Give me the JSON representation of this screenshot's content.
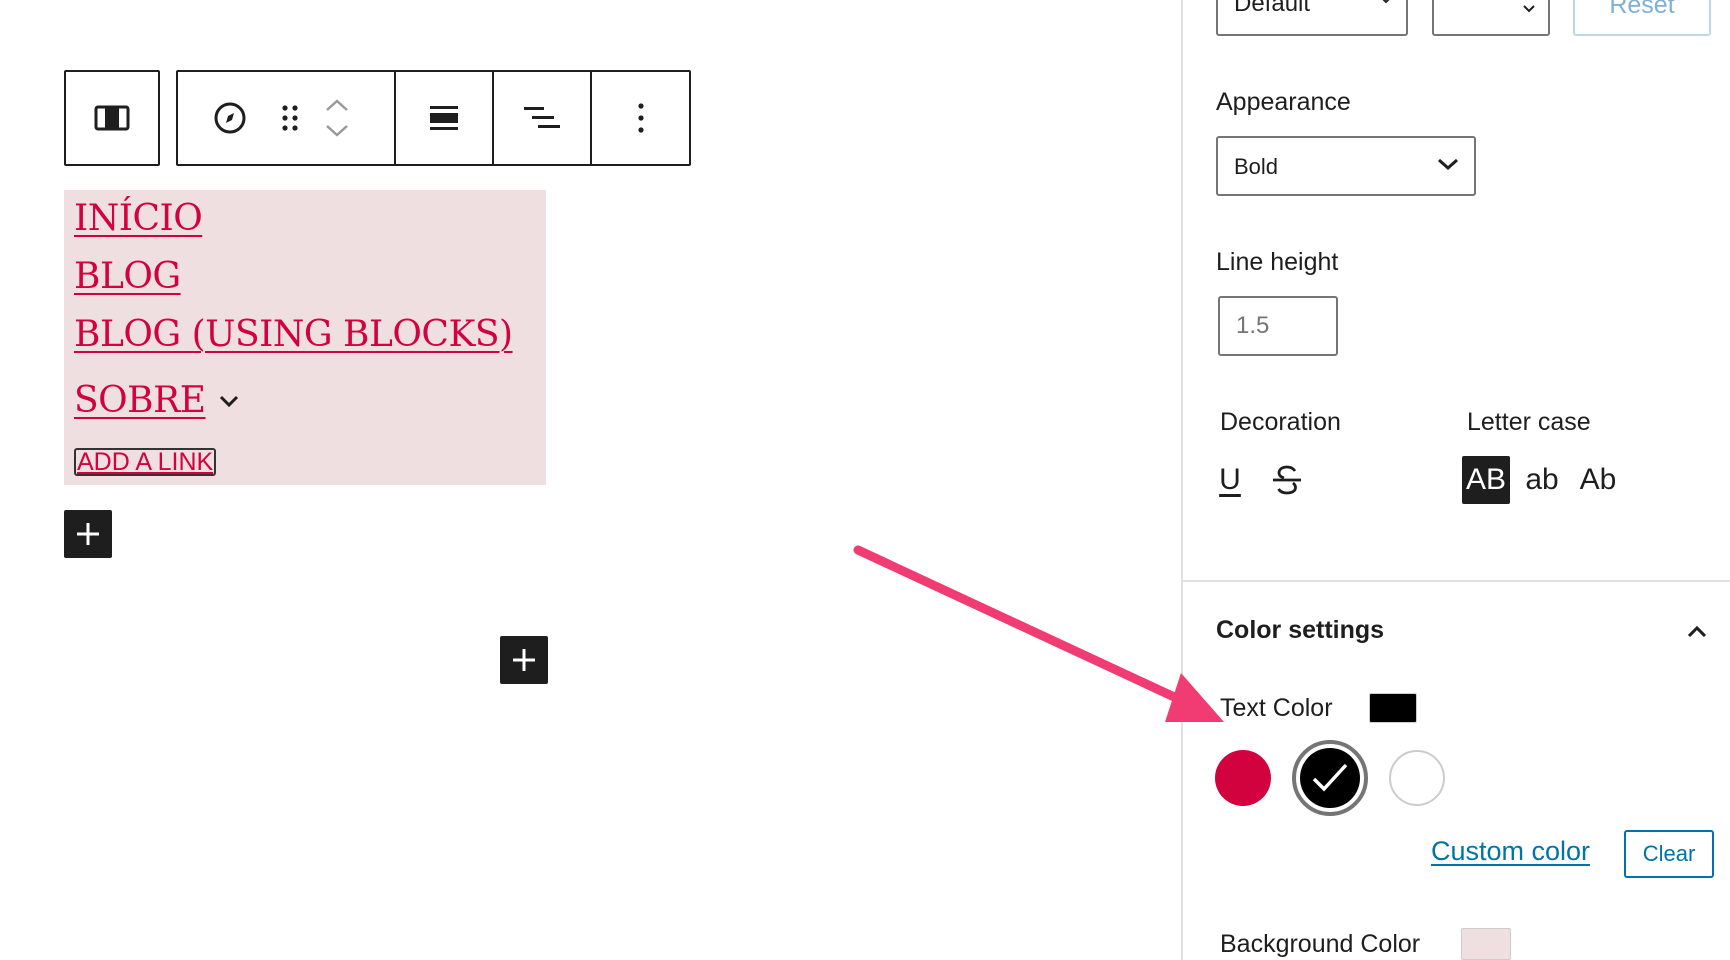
{
  "toolbar": {
    "parent_icon": "navigation-parent-icon",
    "compass_icon": "compass-icon",
    "drag_icon": "drag-handle-icon",
    "up_icon": "chevron-up-icon",
    "down_icon": "chevron-down-icon",
    "justify_icon": "justify-icon",
    "align_icon": "align-icon",
    "more_icon": "more-vertical-icon"
  },
  "navigation": {
    "items": [
      {
        "label": "INÍCIO"
      },
      {
        "label": "BLOG"
      },
      {
        "label": "BLOG (USING BLOCKS)"
      },
      {
        "label": "SOBRE",
        "has_submenu": true
      }
    ],
    "add_link_label": "ADD A LINK",
    "text_color": "#d1023e",
    "background_color": "#f0dfe1"
  },
  "typography": {
    "font_size_select": "Default",
    "unit_select": "",
    "reset_label": "Reset",
    "appearance_label": "Appearance",
    "appearance_value": "Bold",
    "line_height_label": "Line height",
    "line_height_placeholder": "1.5",
    "decoration_label": "Decoration",
    "decoration_underline": "U",
    "letter_case_label": "Letter case",
    "case_upper": "AB",
    "case_lower": "ab",
    "case_capitalize": "Ab",
    "selected_case": "uppercase"
  },
  "color_settings": {
    "title": "Color settings",
    "text_color_label": "Text Color",
    "text_color_value": "#000000",
    "palette": [
      {
        "color": "#d1023e",
        "selected": false
      },
      {
        "color": "#000000",
        "selected": true
      },
      {
        "color": "#ffffff",
        "selected": false
      }
    ],
    "custom_color_label": "Custom color",
    "clear_label": "Clear",
    "background_color_label": "Background Color",
    "background_color_value": "#f0dfe1"
  },
  "annotation": {
    "arrow_color": "#f03c73"
  }
}
